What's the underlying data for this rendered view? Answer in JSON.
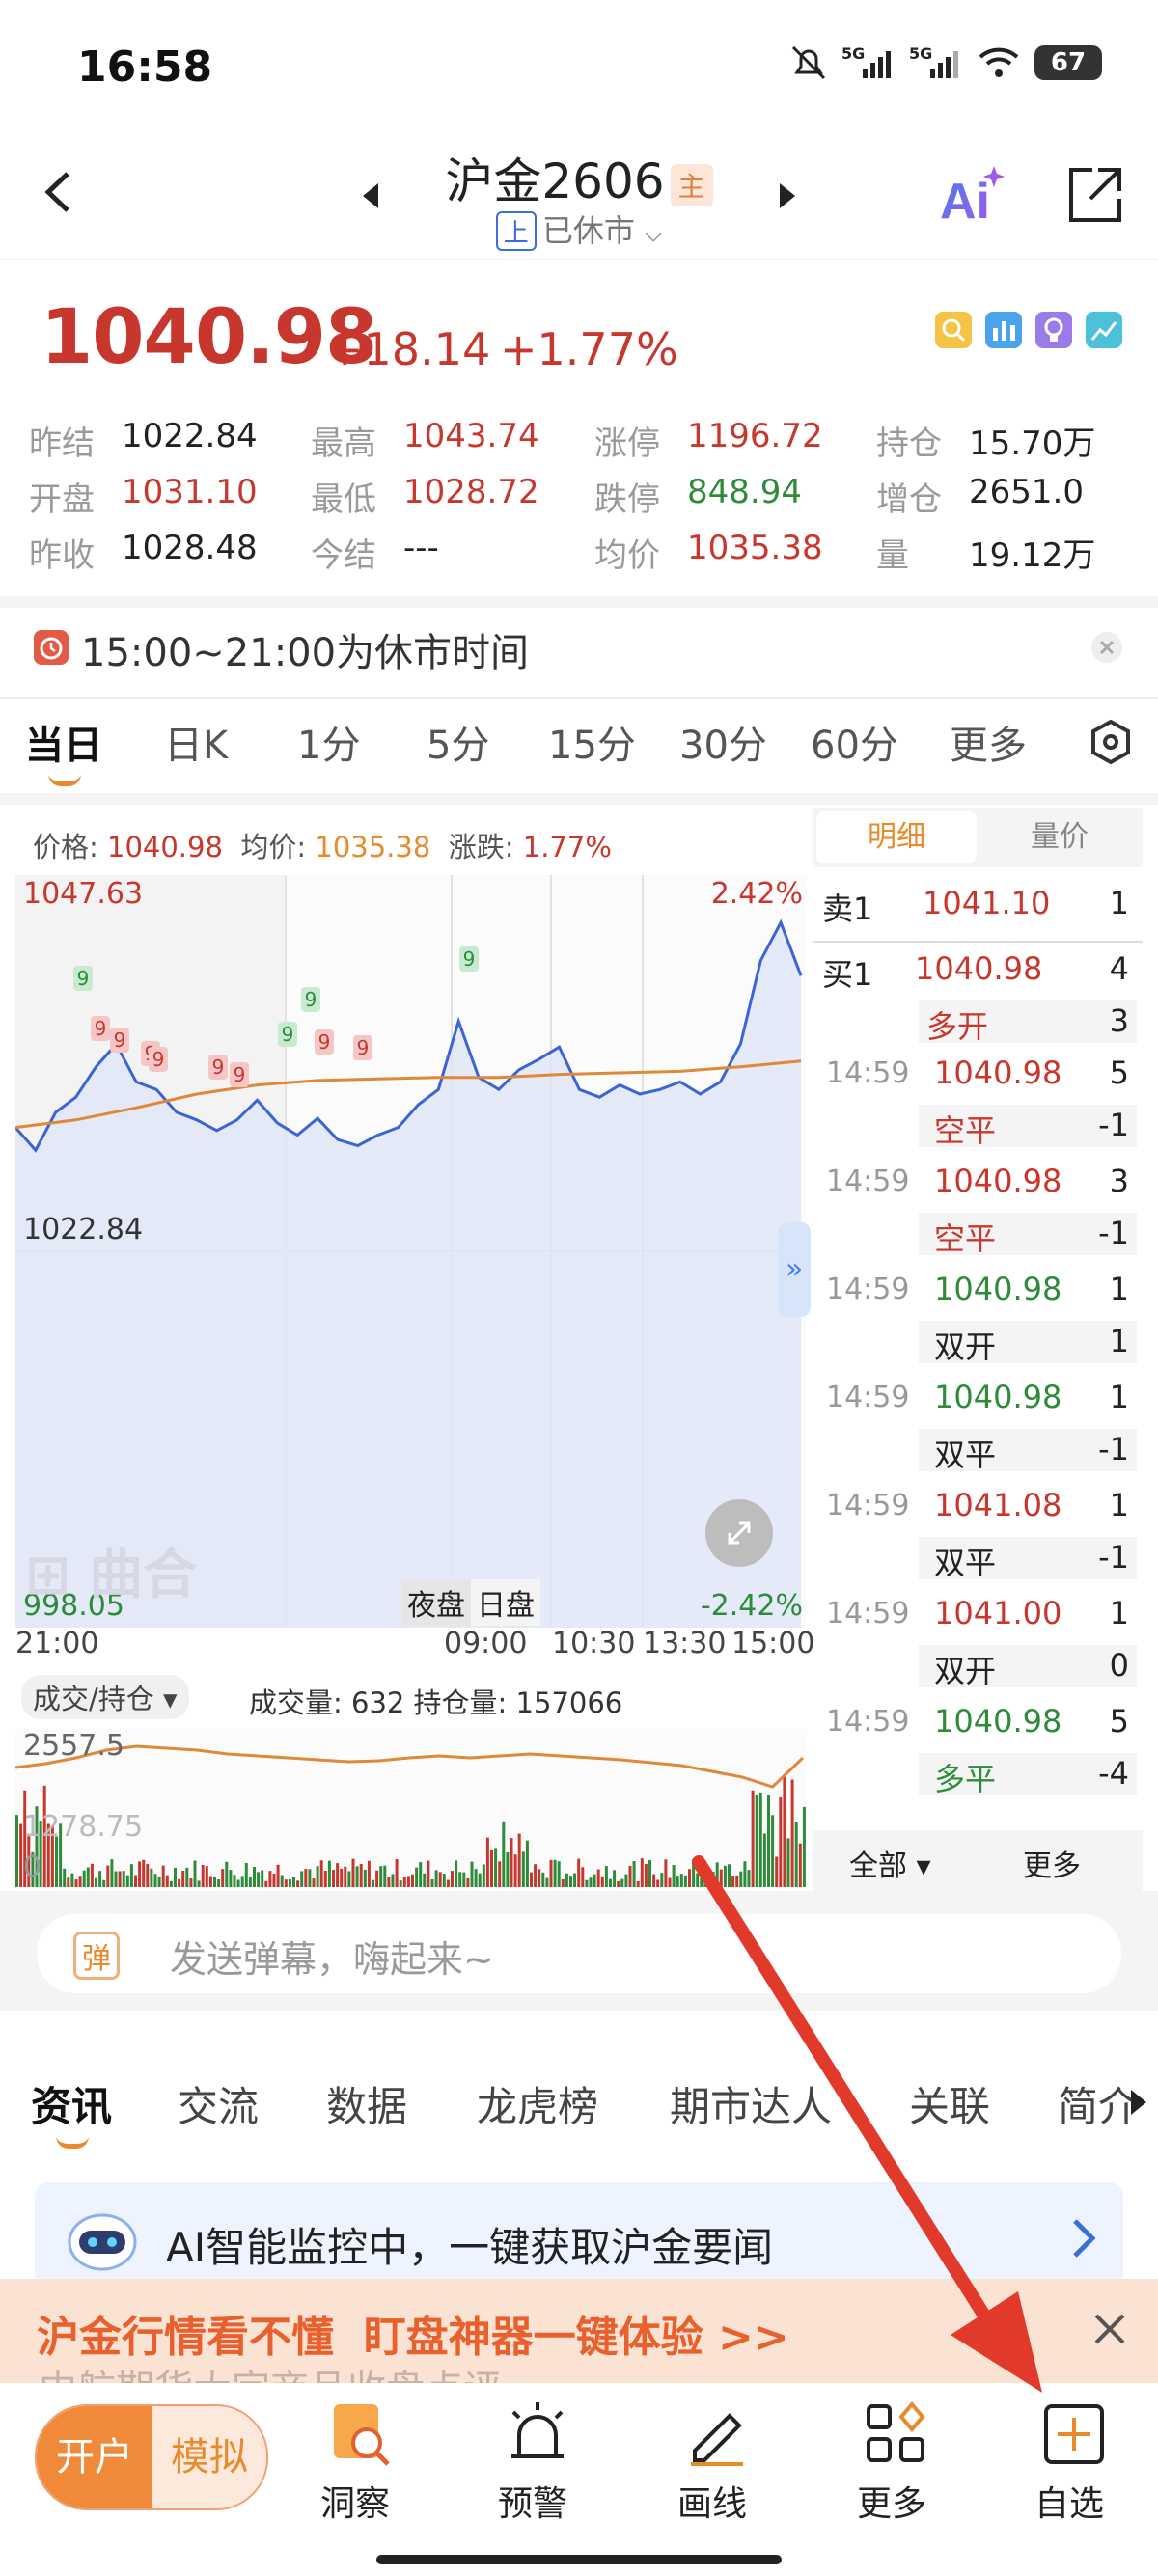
{
  "status": {
    "time": "16:58",
    "battery": "67"
  },
  "header": {
    "title": "沪金2606",
    "main_tag": "主",
    "exchange_tag": "上",
    "status": "已休市"
  },
  "quote": {
    "price": "1040.98",
    "change": "+18.14",
    "change_pct": "+1.77%",
    "stats": [
      {
        "label": "昨结",
        "value": "1022.84",
        "color": "#222222"
      },
      {
        "label": "最高",
        "value": "1043.74",
        "color": "#c8372d"
      },
      {
        "label": "涨停",
        "value": "1196.72",
        "color": "#c8372d"
      },
      {
        "label": "持仓",
        "value": "15.70万",
        "color": "#222222"
      },
      {
        "label": "开盘",
        "value": "1031.10",
        "color": "#c8372d"
      },
      {
        "label": "最低",
        "value": "1028.72",
        "color": "#c8372d"
      },
      {
        "label": "跌停",
        "value": "848.94",
        "color": "#2e8b3a"
      },
      {
        "label": "增仓",
        "value": "2651.0",
        "color": "#222222"
      },
      {
        "label": "昨收",
        "value": "1028.48",
        "color": "#222222"
      },
      {
        "label": "今结",
        "value": "---",
        "color": "#222222"
      },
      {
        "label": "均价",
        "value": "1035.38",
        "color": "#c8372d"
      },
      {
        "label": "量",
        "value": "19.12万",
        "color": "#222222"
      }
    ]
  },
  "notice": {
    "text": "15:00~21:00为休市时间"
  },
  "tabs": [
    "当日",
    "日K",
    "1分",
    "5分",
    "15分",
    "30分",
    "60分",
    "更多"
  ],
  "chart": {
    "info": {
      "price_label": "价格:",
      "price": "1040.98",
      "avg_label": "均价:",
      "avg": "1035.38",
      "chg_label": "涨跌:",
      "chg": "1.77%"
    },
    "y_top": "1047.63",
    "y_mid": "1022.84",
    "y_bot": "998.05",
    "pct_top": "2.42%",
    "pct_bot": "-2.42%",
    "x_ticks": [
      "21:00",
      "09:00",
      "10:30",
      "13:30",
      "15:00"
    ],
    "session_night": "夜盘",
    "session_day": "日盘",
    "watermark": "曲合",
    "vol_selector": "成交/持仓",
    "vol_info": "成交量: 632 持仓量: 157066",
    "vol_top": "2557.5",
    "vol_mid": "1278.75",
    "vol_bot": "0",
    "marker": "9"
  },
  "chart_data": {
    "type": "line",
    "x": [
      "21:00",
      "09:00",
      "10:30",
      "13:30",
      "15:00"
    ],
    "series": [
      {
        "name": "价格",
        "values": [
          1030.2,
          1036.5,
          1028.9,
          1033.0,
          1040.98
        ]
      },
      {
        "name": "均价",
        "values": [
          1031.0,
          1034.5,
          1034.2,
          1035.0,
          1035.38
        ]
      }
    ],
    "ylim": [
      998.05,
      1047.63
    ]
  },
  "side": {
    "tab_detail": "明细",
    "tab_vol": "量价",
    "sell_label": "卖1",
    "sell_price": "1041.10",
    "sell_qty": "1",
    "buy_label": "买1",
    "buy_price": "1040.98",
    "buy_qty": "4",
    "first_tag": "多开",
    "first_tag_qty": "3",
    "trades": [
      {
        "time": "14:59",
        "price": "1040.98",
        "pc": "#c8372d",
        "qty": "5",
        "tag": "空平",
        "tc": "#c8372d",
        "tq": "-1"
      },
      {
        "time": "14:59",
        "price": "1040.98",
        "pc": "#c8372d",
        "qty": "3",
        "tag": "空平",
        "tc": "#c8372d",
        "tq": "-1"
      },
      {
        "time": "14:59",
        "price": "1040.98",
        "pc": "#2e8b3a",
        "qty": "1",
        "tag": "双开",
        "tc": "#222222",
        "tq": "1"
      },
      {
        "time": "14:59",
        "price": "1040.98",
        "pc": "#2e8b3a",
        "qty": "1",
        "tag": "双平",
        "tc": "#222222",
        "tq": "-1"
      },
      {
        "time": "14:59",
        "price": "1041.08",
        "pc": "#c8372d",
        "qty": "1",
        "tag": "双平",
        "tc": "#222222",
        "tq": "-1"
      },
      {
        "time": "14:59",
        "price": "1041.00",
        "pc": "#c8372d",
        "qty": "1",
        "tag": "双开",
        "tc": "#222222",
        "tq": "0"
      },
      {
        "time": "14:59",
        "price": "1040.98",
        "pc": "#2e8b3a",
        "qty": "5",
        "tag": "多平",
        "tc": "#2e8b3a",
        "tq": "-4"
      }
    ],
    "all": "全部",
    "more": "更多"
  },
  "danmaku": {
    "icon_text": "弹",
    "placeholder": "发送弹幕，嗨起来~"
  },
  "news_tabs": [
    "资讯",
    "交流",
    "数据",
    "龙虎榜",
    "期市达人",
    "关联",
    "简介"
  ],
  "ai_banner": "AI智能监控中，一键获取沪金要闻",
  "promo": "沪金行情看不懂  盯盘神器一键体验 >>",
  "promo_under": "中航期货大宗商品收盘点评",
  "bottom": {
    "open": "开户",
    "sim": "模拟",
    "items": [
      {
        "label": "洞察"
      },
      {
        "label": "预警"
      },
      {
        "label": "画线"
      },
      {
        "label": "更多"
      },
      {
        "label": "自选"
      }
    ]
  }
}
